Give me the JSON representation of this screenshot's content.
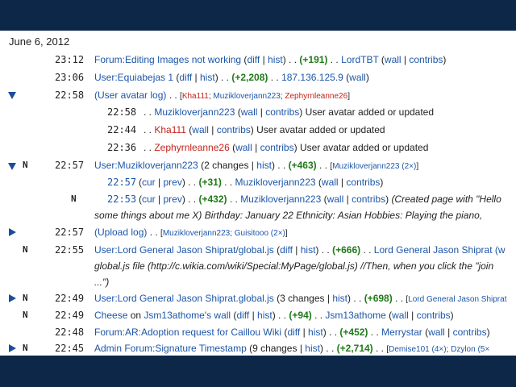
{
  "date": "June 6, 2012",
  "colors": {
    "band": "#0c2748",
    "link": "#1c56a8",
    "redlink": "#c4231b",
    "plus": "#1f7a18",
    "triangle": "#1a4e9c"
  },
  "rows": [
    {
      "time": "23:12",
      "title": "Forum:Editing Images not working",
      "diff": "diff",
      "hist": "hist",
      "sep": " . . ",
      "delta": "(+191)",
      "user": "LordTBT",
      "wall": "wall",
      "contribs": "contribs"
    },
    {
      "time": "23:06",
      "title": "User:Equiabejas 1",
      "diff": "diff",
      "hist": "hist",
      "sep": " . . ",
      "delta": "(+2,208)",
      "user": "187.136.125.9",
      "wall": "wall"
    },
    {
      "time": "22:58",
      "title": "(User avatar log)",
      "users": [
        "Kha111",
        "Muzikloverjann223",
        "Zephyrnleanne26"
      ],
      "sub": [
        {
          "time": "22:58",
          "user": "Muzikloverjann223",
          "wall": "wall",
          "contribs": "contribs",
          "summary": "User avatar added or updated"
        },
        {
          "time": "22:44",
          "user": "Kha111",
          "wall": "wall",
          "contribs": "contribs",
          "summary": "User avatar added or updated"
        },
        {
          "time": "22:36",
          "user": "Zephyrnleanne26",
          "wall": "wall",
          "contribs": "contribs",
          "summary": "User avatar added or updated"
        }
      ]
    },
    {
      "flag": "N",
      "time": "22:57",
      "title": "User:Muzikloverjann223",
      "changes": "2 changes",
      "hist": "hist",
      "delta": "(+463)",
      "users": "Muzikloverjann223 (2×)",
      "sub": [
        {
          "time": "22:57",
          "cur": "cur",
          "prev": "prev",
          "delta": "(+31)",
          "user": "Muzikloverjann223",
          "wall": "wall",
          "contribs": "contribs"
        },
        {
          "flag": "N",
          "time": "22:53",
          "cur": "cur",
          "prev": "prev",
          "delta": "(+432)",
          "user": "Muzikloverjann223",
          "wall": "wall",
          "contribs": "contribs",
          "summary": "(Created page with \"Hello",
          "summary2": "some things about me X) Birthday: January 22 Ethnicity: Asian Hobbies: Playing the piano,"
        }
      ]
    },
    {
      "time": "22:57",
      "title": "(Upload log)",
      "users": [
        "Muzikloverjann223",
        "Guisitooo (2×)"
      ]
    },
    {
      "flag": "N",
      "time": "22:55",
      "title": "User:Lord General Jason Shiprat/global.js",
      "diff": "diff",
      "hist": "hist",
      "delta": "(+666)",
      "user": "Lord General Jason Shiprat (w",
      "summary": "global.js file (http://c.wikia.com/wiki/Special:MyPage/global.js) //Then, when you click the \"join",
      "summary2": "...\")"
    },
    {
      "flag": "N",
      "time": "22:49",
      "title": "User:Lord General Jason Shiprat.global.js",
      "changes": "3 changes",
      "hist": "hist",
      "delta": "(+698)",
      "users": "Lord General Jason Shiprat"
    },
    {
      "flag": "N",
      "time": "22:49",
      "title": "Cheese",
      "on": "on",
      "wallpage": "Jsm13athome's wall",
      "diff": "diff",
      "hist": "hist",
      "delta": "(+94)",
      "user": "Jsm13athome",
      "wall": "wall",
      "contribs": "contribs"
    },
    {
      "time": "22:48",
      "title": "Forum:AR:Adoption request for Caillou Wiki",
      "diff": "diff",
      "hist": "hist",
      "delta": "(+452)",
      "user": "Merrystar",
      "wall": "wall",
      "contribs": "contribs"
    },
    {
      "flag": "N",
      "time": "22:45",
      "title": "Admin Forum:Signature Timestamp",
      "changes": "9 changes",
      "hist": "hist",
      "delta": "(+2,714)",
      "users": [
        "Demise101 (4×)",
        "Dzylon (5×"
      ]
    }
  ]
}
